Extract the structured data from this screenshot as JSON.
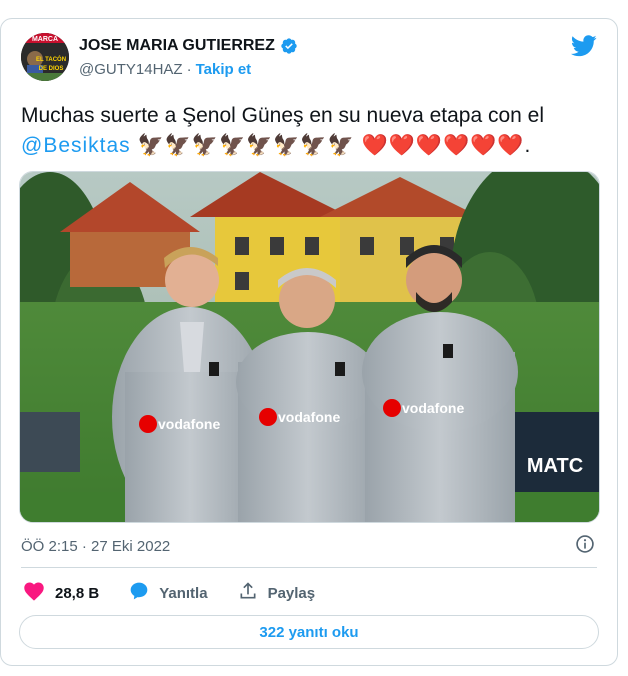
{
  "author": {
    "name": "JOSE MARIA GUTIERREZ",
    "handle": "@GUTY14HAZ",
    "separator": "·",
    "follow_label": "Takip et",
    "avatar_text_top": "MARCA",
    "avatar_text_mid": "EL TACÓN",
    "avatar_text_bot": "DE DIOS"
  },
  "tweet": {
    "text_line1": "Muchas suerte a Şenol Güneş en su nueva etapa con el",
    "mention": "@Besiktas",
    "eagles": "🦅🦅🦅🦅🦅🦅🦅🦅",
    "hearts": "❤️❤️❤️❤️❤️❤️",
    "end": "."
  },
  "photo": {
    "sponsor_text": "vodafone",
    "sign_text": "MATC"
  },
  "meta": {
    "timestamp": "ÖÖ 2:15 · 27 Eki 2022"
  },
  "actions": {
    "like_count": "28,8 B",
    "reply_label": "Yanıtla",
    "share_label": "Paylaş"
  },
  "replies_button": "322 yanıtı oku",
  "colors": {
    "accent": "#1d9bf0",
    "like": "#f91880",
    "text": "#0f1419",
    "muted": "#536471",
    "border": "#cfd9de"
  }
}
